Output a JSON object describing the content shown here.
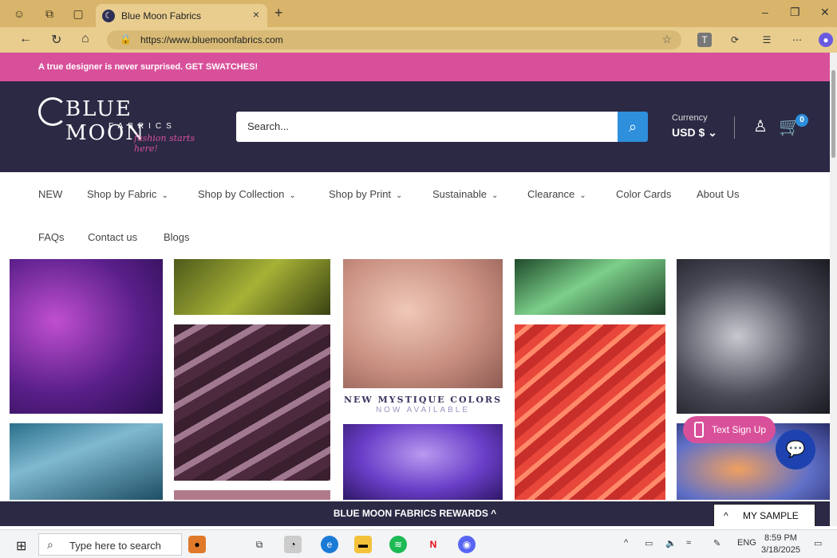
{
  "browser": {
    "tab_title": "Blue Moon Fabrics",
    "tab_close": "×",
    "new_tab": "+",
    "url": "https://www.bluemoonfabrics.com",
    "window_controls": [
      "–",
      "❐",
      "✕"
    ]
  },
  "promo": {
    "text": "A true designer is never surprised. GET SWATCHES!"
  },
  "header": {
    "logo_text": "BLUE MOON",
    "logo_sub": "FABRICS",
    "logo_tagline": "fashion starts here!",
    "search_placeholder": "Search...",
    "currency_label": "Currency",
    "currency_value": "USD $ ⌄",
    "cart_count": "0"
  },
  "nav": {
    "items": [
      {
        "label": "NEW",
        "chev": ""
      },
      {
        "label": "Shop by Fabric",
        "chev": "⌄"
      },
      {
        "label": "Shop by Collection",
        "chev": "⌄"
      },
      {
        "label": "Shop by Print",
        "chev": "⌄"
      },
      {
        "label": "Sustainable",
        "chev": "⌄"
      },
      {
        "label": "Clearance",
        "chev": "⌄"
      },
      {
        "label": "Color Cards",
        "chev": ""
      },
      {
        "label": "About Us",
        "chev": ""
      },
      {
        "label": "FAQs",
        "chev": ""
      },
      {
        "label": "Contact us",
        "chev": ""
      },
      {
        "label": "Blogs",
        "chev": ""
      }
    ]
  },
  "banner": {
    "line1": "NEW MYSTIQUE COLORS",
    "line2": "NOW AVAILABLE"
  },
  "widgets": {
    "text_signup": "Text Sign Up",
    "rewards": "BLUE MOON FABRICS REWARDS ^",
    "my_sample": "MY SAMPLE"
  },
  "taskbar": {
    "search_placeholder": "Type here to search",
    "lang": "ENG",
    "time": "8:59 PM",
    "date": "3/18/2025"
  },
  "colors": {
    "promo": "#d9509a",
    "header": "#2b2944",
    "accent": "#2e8fdc"
  }
}
